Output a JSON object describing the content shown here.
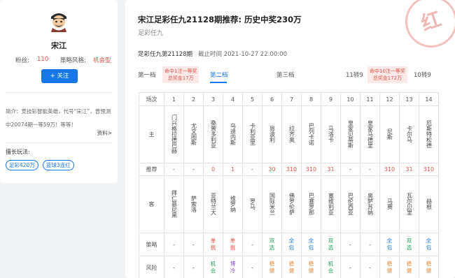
{
  "sidebar": {
    "avatar_icon": "avatar-cartoon",
    "name": "宋江",
    "fans_label": "粉丝:",
    "fans_value": "110",
    "style_label": "策略风格:",
    "style_value": "机会型",
    "follow_label": "+ 关注",
    "bio": "简介：竞技彩智能英雄，代号“宋江”，曾预测中20074期一等59万！等等！",
    "more_label": "资料>",
    "skills_title": "擅长玩法:",
    "skills": [
      "足彩420万",
      "篮球3连红"
    ]
  },
  "main": {
    "stamp_text": "红",
    "title": "宋江足彩任九21128期推荐: 历史中奖230万",
    "subtitle": "足彩任九",
    "period": "足彩任九第21128期",
    "deadline": "截止时间 2021-10-27 22:00:00",
    "tabs": [
      {
        "label": "第一档",
        "active": false
      },
      {
        "label": "第二档",
        "active": true
      },
      {
        "label": "第三档",
        "active": false
      },
      {
        "label": "11转9",
        "active": false
      },
      {
        "label": "10转9",
        "active": false
      }
    ],
    "badges": [
      {
        "line1": "命中1注一等奖",
        "line2": "总奖金17万"
      },
      {
        "line1": "命中10注一等奖",
        "line2": "总奖金172万"
      }
    ],
    "table": {
      "row_labels": [
        "场次",
        "主",
        "推荐",
        "客",
        "策略",
        "风险"
      ],
      "numbers": [
        "1",
        "2",
        "3",
        "4",
        "5",
        "6",
        "7",
        "8",
        "9",
        "10",
        "11",
        "12",
        "13",
        "14"
      ],
      "home": [
        "门兴格拉德巴赫",
        "尤文图斯",
        "桑普多利亚",
        "乌迪内斯",
        "卡利亚里",
        "恩波利",
        "拉齐奥",
        "巴列卡诺",
        "马洛卡",
        "皇家贝蒂斯",
        "皇家马德里",
        "尼斯",
        "卡尔马",
        "厄斯特松德"
      ],
      "recommend": [
        "-",
        "-",
        "0",
        "1",
        "-",
        "30",
        "310",
        "310",
        "31",
        "-",
        "-",
        "310",
        "31",
        "310"
      ],
      "away": [
        "拜仁慕尼黑",
        "萨索洛",
        "亚特兰大",
        "维罗纳",
        "罗马",
        "国际米兰",
        "佛罗伦萨",
        "巴塞罗那",
        "塞维利亚",
        "巴伦西亚",
        "奥萨苏纳",
        "马赛",
        "瓦尔贝里",
        "赫根"
      ],
      "strategy": [
        "-",
        "-",
        "单挑",
        "单挑",
        "-",
        "双选",
        "全包",
        "全包",
        "双选",
        "-",
        "-",
        "全包",
        "双选",
        "全包"
      ],
      "risk": [
        "-",
        "-",
        "机会",
        "博冷",
        "-",
        "稳健",
        "稳健",
        "稳健",
        "机会",
        "-",
        "-",
        "稳健",
        "稳健",
        "稳健"
      ]
    },
    "colors": {
      "accent": "#1677e8",
      "red": "#e5544b",
      "green": "#22a35a",
      "purple": "#8a4fd1",
      "orange": "#e8893a"
    }
  }
}
